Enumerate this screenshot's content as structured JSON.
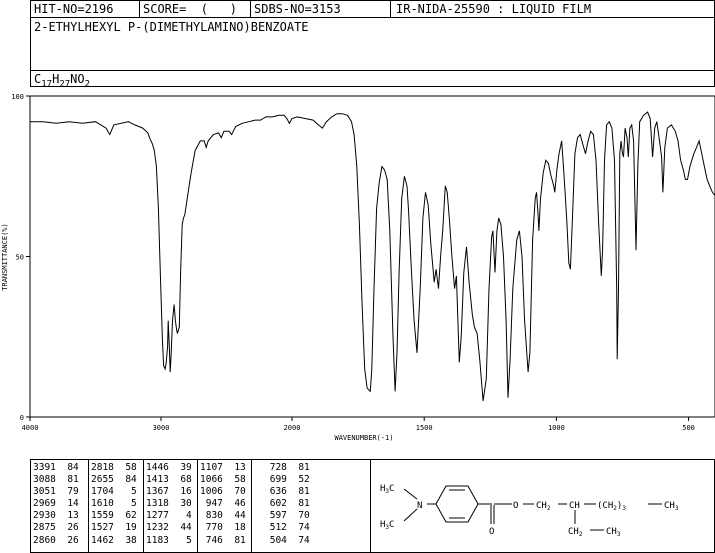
{
  "header": {
    "hit_no": "HIT-NO=2196",
    "score": "SCORE=  (   )",
    "sdbs_no": "SDBS-NO=3153",
    "source": "IR-NIDA-25590 : LIQUID FILM"
  },
  "compound_name": "2-ETHYLHEXYL P-(DIMETHYLAMINO)BENZOATE",
  "formula": {
    "c": "C",
    "c_n": "17",
    "h": "H",
    "h_n": "27",
    "rest": "NO",
    "o_n": "2"
  },
  "chart_data": {
    "type": "line",
    "xlabel": "WAVENUMBER(-1)",
    "ylabel": "TRANSMITTANCE(%)",
    "xlim": [
      4000,
      400
    ],
    "ylim": [
      0,
      100
    ],
    "x_ticks": [
      4000,
      3000,
      2000,
      1500,
      1000,
      500
    ],
    "y_ticks": [
      0,
      50,
      100
    ],
    "x_tick_labels": [
      "4000",
      "3000",
      "2000",
      "1500",
      "1000",
      "500"
    ],
    "y_tick_labels": [
      "0",
      "50",
      "100"
    ],
    "series": [
      {
        "points": [
          [
            4000,
            92
          ],
          [
            3900,
            92
          ],
          [
            3800,
            91.5
          ],
          [
            3700,
            92
          ],
          [
            3600,
            91.5
          ],
          [
            3500,
            92
          ],
          [
            3420,
            90
          ],
          [
            3391,
            88
          ],
          [
            3360,
            91
          ],
          [
            3250,
            92
          ],
          [
            3200,
            91
          ],
          [
            3140,
            90
          ],
          [
            3100,
            88.5
          ],
          [
            3088,
            87
          ],
          [
            3065,
            85
          ],
          [
            3051,
            83
          ],
          [
            3035,
            78
          ],
          [
            3020,
            65
          ],
          [
            3005,
            45
          ],
          [
            2990,
            25
          ],
          [
            2980,
            16
          ],
          [
            2969,
            15
          ],
          [
            2960,
            17
          ],
          [
            2950,
            22
          ],
          [
            2945,
            30
          ],
          [
            2937,
            22
          ],
          [
            2930,
            14
          ],
          [
            2922,
            20
          ],
          [
            2912,
            30
          ],
          [
            2900,
            35
          ],
          [
            2890,
            30
          ],
          [
            2880,
            27
          ],
          [
            2875,
            26
          ],
          [
            2868,
            27
          ],
          [
            2860,
            28
          ],
          [
            2850,
            45
          ],
          [
            2838,
            60
          ],
          [
            2828,
            62
          ],
          [
            2818,
            63
          ],
          [
            2800,
            68
          ],
          [
            2770,
            76
          ],
          [
            2740,
            83
          ],
          [
            2700,
            86
          ],
          [
            2670,
            86
          ],
          [
            2655,
            84
          ],
          [
            2640,
            86
          ],
          [
            2600,
            88
          ],
          [
            2560,
            88.5
          ],
          [
            2540,
            87
          ],
          [
            2520,
            89
          ],
          [
            2480,
            89
          ],
          [
            2460,
            88
          ],
          [
            2430,
            90.5
          ],
          [
            2380,
            91.5
          ],
          [
            2330,
            92
          ],
          [
            2280,
            92.5
          ],
          [
            2240,
            92.5
          ],
          [
            2220,
            93
          ],
          [
            2200,
            93.5
          ],
          [
            2150,
            93.5
          ],
          [
            2100,
            94
          ],
          [
            2060,
            94
          ],
          [
            2040,
            93
          ],
          [
            2020,
            91.5
          ],
          [
            2000,
            93
          ],
          [
            1980,
            93.5
          ],
          [
            1950,
            93
          ],
          [
            1920,
            92.5
          ],
          [
            1900,
            91
          ],
          [
            1885,
            90
          ],
          [
            1870,
            92
          ],
          [
            1850,
            93.5
          ],
          [
            1830,
            94.5
          ],
          [
            1810,
            94.5
          ],
          [
            1790,
            94
          ],
          [
            1775,
            92
          ],
          [
            1765,
            88
          ],
          [
            1755,
            78
          ],
          [
            1745,
            60
          ],
          [
            1735,
            35
          ],
          [
            1725,
            15
          ],
          [
            1716,
            9
          ],
          [
            1704,
            8
          ],
          [
            1698,
            15
          ],
          [
            1690,
            40
          ],
          [
            1680,
            65
          ],
          [
            1670,
            73
          ],
          [
            1660,
            78
          ],
          [
            1650,
            77
          ],
          [
            1640,
            74
          ],
          [
            1630,
            58
          ],
          [
            1618,
            25
          ],
          [
            1610,
            8
          ],
          [
            1603,
            20
          ],
          [
            1595,
            45
          ],
          [
            1585,
            68
          ],
          [
            1575,
            75
          ],
          [
            1565,
            72
          ],
          [
            1559,
            64
          ],
          [
            1548,
            45
          ],
          [
            1538,
            30
          ],
          [
            1527,
            20
          ],
          [
            1515,
            40
          ],
          [
            1505,
            62
          ],
          [
            1495,
            70
          ],
          [
            1485,
            66
          ],
          [
            1475,
            54
          ],
          [
            1462,
            42
          ],
          [
            1455,
            46
          ],
          [
            1446,
            40
          ],
          [
            1438,
            50
          ],
          [
            1430,
            58
          ],
          [
            1420,
            72
          ],
          [
            1413,
            70
          ],
          [
            1405,
            62
          ],
          [
            1395,
            50
          ],
          [
            1385,
            40
          ],
          [
            1378,
            44
          ],
          [
            1367,
            17
          ],
          [
            1360,
            25
          ],
          [
            1350,
            45
          ],
          [
            1340,
            53
          ],
          [
            1330,
            42
          ],
          [
            1318,
            32
          ],
          [
            1310,
            28
          ],
          [
            1300,
            26
          ],
          [
            1290,
            18
          ],
          [
            1277,
            5
          ],
          [
            1265,
            12
          ],
          [
            1255,
            40
          ],
          [
            1245,
            56
          ],
          [
            1240,
            58
          ],
          [
            1232,
            45
          ],
          [
            1225,
            58
          ],
          [
            1218,
            62
          ],
          [
            1210,
            60
          ],
          [
            1200,
            50
          ],
          [
            1190,
            30
          ],
          [
            1183,
            6
          ],
          [
            1175,
            18
          ],
          [
            1165,
            40
          ],
          [
            1150,
            55
          ],
          [
            1140,
            58
          ],
          [
            1130,
            50
          ],
          [
            1120,
            30
          ],
          [
            1107,
            14
          ],
          [
            1100,
            20
          ],
          [
            1090,
            55
          ],
          [
            1080,
            68
          ],
          [
            1075,
            70
          ],
          [
            1070,
            64
          ],
          [
            1066,
            58
          ],
          [
            1060,
            68
          ],
          [
            1050,
            76
          ],
          [
            1040,
            80
          ],
          [
            1030,
            79
          ],
          [
            1020,
            75
          ],
          [
            1010,
            72
          ],
          [
            1006,
            70
          ],
          [
            998,
            77
          ],
          [
            990,
            82
          ],
          [
            980,
            86
          ],
          [
            975,
            80
          ],
          [
            967,
            70
          ],
          [
            960,
            60
          ],
          [
            953,
            48
          ],
          [
            947,
            46
          ],
          [
            940,
            60
          ],
          [
            930,
            82
          ],
          [
            920,
            87
          ],
          [
            910,
            88
          ],
          [
            900,
            85
          ],
          [
            890,
            82
          ],
          [
            880,
            86
          ],
          [
            870,
            89
          ],
          [
            860,
            88
          ],
          [
            850,
            80
          ],
          [
            840,
            60
          ],
          [
            830,
            44
          ],
          [
            825,
            52
          ],
          [
            818,
            80
          ],
          [
            810,
            91
          ],
          [
            800,
            92
          ],
          [
            790,
            90
          ],
          [
            780,
            80
          ],
          [
            772,
            40
          ],
          [
            770,
            18
          ],
          [
            765,
            40
          ],
          [
            760,
            82
          ],
          [
            755,
            86
          ],
          [
            750,
            82
          ],
          [
            746,
            81
          ],
          [
            740,
            90
          ],
          [
            733,
            87
          ],
          [
            728,
            81
          ],
          [
            722,
            90
          ],
          [
            715,
            91
          ],
          [
            708,
            86
          ],
          [
            699,
            52
          ],
          [
            692,
            78
          ],
          [
            685,
            92
          ],
          [
            670,
            94
          ],
          [
            655,
            95
          ],
          [
            645,
            93
          ],
          [
            636,
            81
          ],
          [
            628,
            90
          ],
          [
            620,
            92
          ],
          [
            610,
            86
          ],
          [
            602,
            81
          ],
          [
            597,
            70
          ],
          [
            590,
            84
          ],
          [
            580,
            90
          ],
          [
            565,
            91
          ],
          [
            550,
            89
          ],
          [
            540,
            86
          ],
          [
            530,
            80
          ],
          [
            520,
            77
          ],
          [
            512,
            74
          ],
          [
            504,
            74
          ],
          [
            495,
            78
          ],
          [
            480,
            82
          ],
          [
            470,
            84
          ],
          [
            460,
            86
          ],
          [
            450,
            82
          ],
          [
            440,
            78
          ],
          [
            430,
            74
          ],
          [
            420,
            72
          ],
          [
            410,
            70
          ],
          [
            400,
            69
          ]
        ]
      }
    ]
  },
  "peak_table": {
    "columns": [
      [
        [
          "3391",
          "84"
        ],
        [
          "3088",
          "81"
        ],
        [
          "3051",
          "79"
        ],
        [
          "2969",
          "14"
        ],
        [
          "2930",
          "13"
        ],
        [
          "2875",
          "26"
        ],
        [
          "2860",
          "26"
        ]
      ],
      [
        [
          "2818",
          "58"
        ],
        [
          "2655",
          "84"
        ],
        [
          "1704",
          "5"
        ],
        [
          "1610",
          "5"
        ],
        [
          "1559",
          "62"
        ],
        [
          "1527",
          "19"
        ],
        [
          "1462",
          "38"
        ]
      ],
      [
        [
          "1446",
          "39"
        ],
        [
          "1413",
          "68"
        ],
        [
          "1367",
          "16"
        ],
        [
          "1318",
          "30"
        ],
        [
          "1277",
          "4"
        ],
        [
          "1232",
          "44"
        ],
        [
          "1183",
          "5"
        ]
      ],
      [
        [
          "1107",
          "13"
        ],
        [
          "1066",
          "58"
        ],
        [
          "1006",
          "70"
        ],
        [
          "947",
          "46"
        ],
        [
          "830",
          "44"
        ],
        [
          "770",
          "18"
        ],
        [
          "746",
          "81"
        ]
      ],
      [
        [
          "728",
          "81"
        ],
        [
          "699",
          "52"
        ],
        [
          "636",
          "81"
        ],
        [
          "602",
          "81"
        ],
        [
          "597",
          "70"
        ],
        [
          "512",
          "74"
        ],
        [
          "504",
          "74"
        ]
      ]
    ]
  },
  "structure_labels": {
    "h3c": "H",
    "h3c_sub": "3",
    "h3c_c": "C",
    "n": "N",
    "o_carbonyl": "O",
    "o_ester": "O",
    "ch2_a": "CH",
    "ch2_a_sub": "2",
    "ch": "CH",
    "chain_open": "(CH",
    "chain_sub": "2",
    "chain_close": ")",
    "chain_n": "3",
    "ch3_end": "CH",
    "ch3_end_sub": "3",
    "ch2_b": "CH",
    "ch2_b_sub": "2",
    "ch3_b": "CH",
    "ch3_b_sub": "3"
  }
}
